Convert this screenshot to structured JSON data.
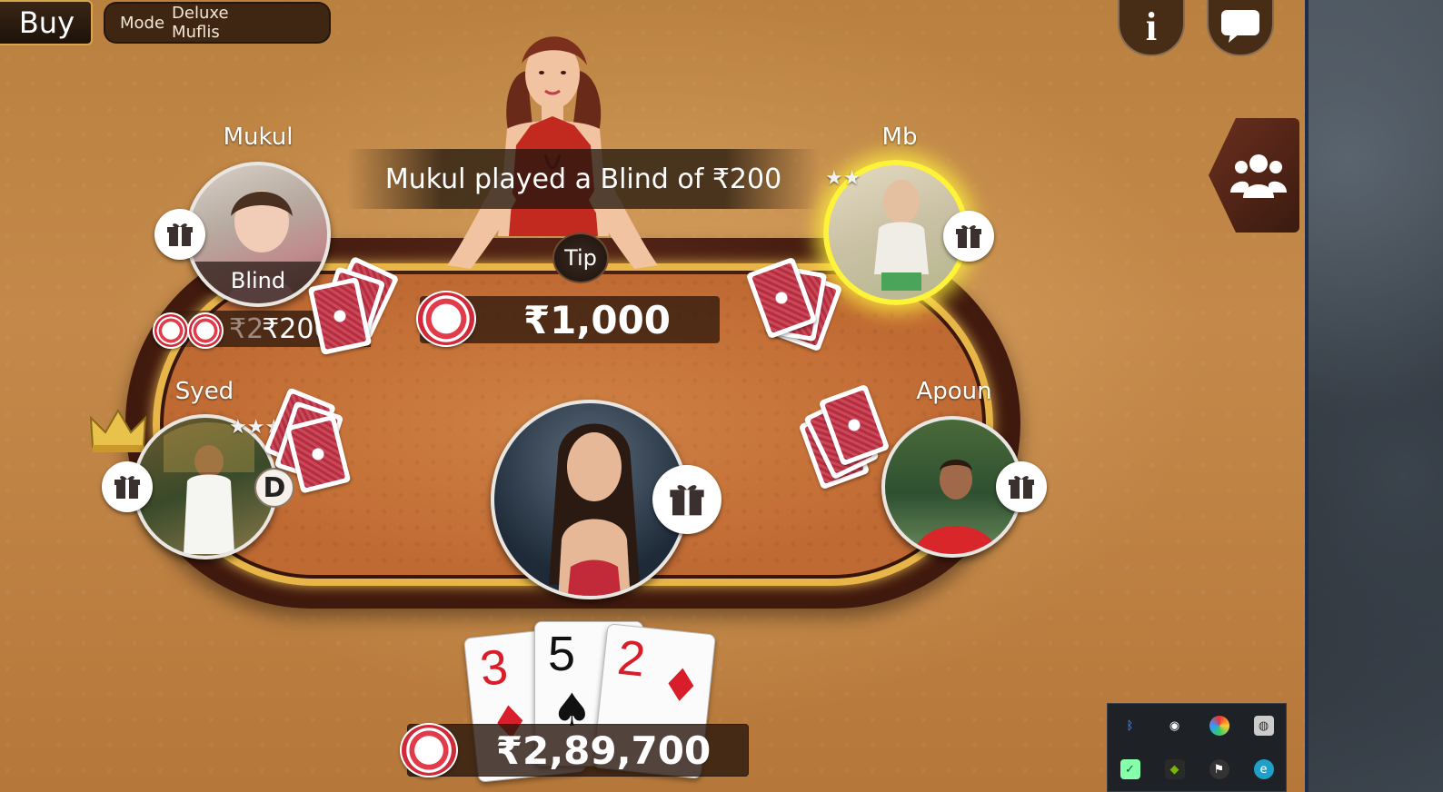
{
  "topbar": {
    "buy_label": "Buy",
    "mode_label": "Mode",
    "mode_line1": "Deluxe",
    "mode_line2": "Muflis",
    "info_label": "i"
  },
  "notice_text": "Mukul played a Blind of ₹200",
  "tip_label": "Tip",
  "pot_amount": "₹1,000",
  "players": {
    "mukul": {
      "name": "Mukul",
      "status": "Blind",
      "bet_ghost": "₹2",
      "bet": "₹200"
    },
    "mb": {
      "name": "Mb",
      "active": true
    },
    "syed": {
      "name": "Syed",
      "dealer_label": "D"
    },
    "apoun": {
      "name": "Apoun"
    }
  },
  "hand": [
    {
      "rank": "3",
      "suit": "♦",
      "color": "red"
    },
    {
      "rank": "5",
      "suit": "♠",
      "color": "black"
    },
    {
      "rank": "2",
      "suit": "♦",
      "color": "red"
    }
  ],
  "balance": "₹2,89,700",
  "tray_icons": [
    "bluetooth-icon",
    "record-icon",
    "colorful-app-icon",
    "disk-icon",
    "security-check-icon",
    "nvidia-icon",
    "bluestacks-icon",
    "edge-icon"
  ],
  "colors": {
    "felt": "#c06a33",
    "gold_rim": "#e7b548",
    "active_glow": "#fff33a",
    "chip_red": "#e23b4a"
  }
}
